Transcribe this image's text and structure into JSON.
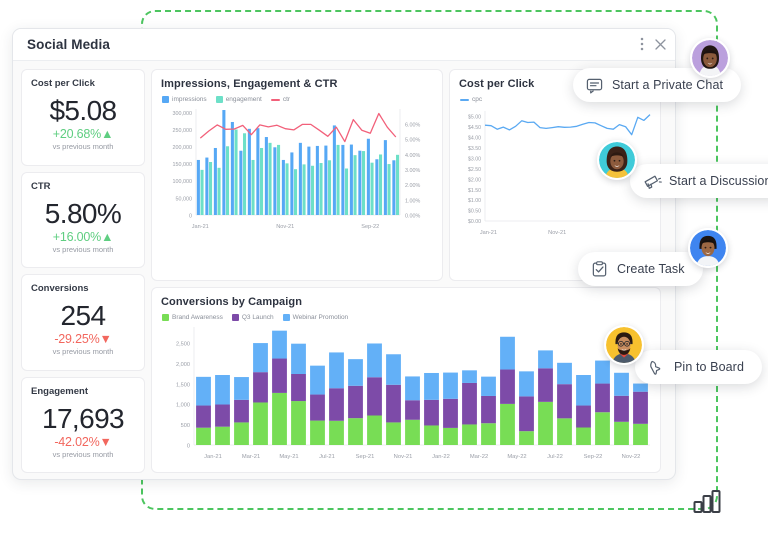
{
  "window": {
    "title": "Social Media",
    "menu_icon": "kebab-menu-icon",
    "close_icon": "close-icon"
  },
  "selection": {
    "icon": "bar-chart-icon",
    "color": "#4cc55f"
  },
  "kpis": [
    {
      "label": "Cost per Click",
      "value": "$5.08",
      "delta": "+20.68%",
      "arrow": "▲",
      "direction": "up",
      "sub": "vs previous month"
    },
    {
      "label": "CTR",
      "value": "5.80%",
      "delta": "+16.00%",
      "arrow": "▲",
      "direction": "up",
      "sub": "vs previous month"
    },
    {
      "label": "Conversions",
      "value": "254",
      "delta": "-29.25%",
      "arrow": "▼",
      "direction": "down",
      "sub": "vs previous month"
    },
    {
      "label": "Engagement",
      "value": "17,693",
      "delta": "-42.02%",
      "arrow": "▼",
      "direction": "down",
      "sub": "vs previous month"
    }
  ],
  "colors": {
    "impressions": "#56a8f5",
    "engagement": "#6de0c8",
    "ctr_line": "#f2607a",
    "cpc_line": "#5aa9f2",
    "brand_awareness": "#78dd55",
    "q3_launch": "#7d4ba8",
    "webinar_promotion": "#63b0f7",
    "positive": "#5fce81",
    "negative": "#f2675e"
  },
  "chart_data": [
    {
      "id": "impressions_engagement_ctr",
      "type": "bar",
      "title": "Impressions, Engagement & CTR",
      "legend": [
        {
          "name": "impressions",
          "marker": "square",
          "color": "#56a8f5"
        },
        {
          "name": "engagement",
          "marker": "square",
          "color": "#6de0c8"
        },
        {
          "name": "ctr",
          "marker": "line",
          "color": "#f2607a"
        }
      ],
      "legend_position": "top-left",
      "grid": false,
      "xlabel": "",
      "ylabel": "",
      "x_ticks": [
        "Jan-21",
        "Nov-21",
        "Sep-22"
      ],
      "x_tick_indices": [
        0,
        10,
        20
      ],
      "ylim": [
        0,
        310000
      ],
      "y_ticks": [
        "0",
        "50,000",
        "100,000",
        "150,000",
        "200,000",
        "250,000",
        "300,000"
      ],
      "y2_label": "CTR",
      "y2lim": [
        0,
        7
      ],
      "y2_ticks": [
        "0.00%",
        "1.00%",
        "2.00%",
        "3.00%",
        "4.00%",
        "5.00%",
        "6.00%"
      ],
      "categories": [
        "Jan-21",
        "Feb-21",
        "Mar-21",
        "Apr-21",
        "May-21",
        "Jun-21",
        "Jul-21",
        "Aug-21",
        "Sep-21",
        "Oct-21",
        "Nov-21",
        "Dec-21",
        "Jan-22",
        "Feb-22",
        "Mar-22",
        "Apr-22",
        "May-22",
        "Jun-22",
        "Jul-22",
        "Aug-22",
        "Sep-22",
        "Oct-22",
        "Nov-22",
        "Dec-22"
      ],
      "series": [
        {
          "name": "impressions",
          "axis": "left",
          "values": [
            161000,
            168000,
            196000,
            307000,
            272000,
            188000,
            252000,
            254000,
            228000,
            198000,
            161000,
            183000,
            211000,
            200000,
            202000,
            203000,
            262000,
            205000,
            206000,
            188000,
            223000,
            163000,
            219000,
            160000
          ]
        },
        {
          "name": "engagement",
          "axis": "left",
          "values": [
            132000,
            155000,
            138000,
            201000,
            250000,
            239000,
            161000,
            196000,
            211000,
            205000,
            151000,
            134000,
            148000,
            144000,
            152000,
            160000,
            205000,
            136000,
            175000,
            187000,
            153000,
            177000,
            149000,
            176000
          ]
        },
        {
          "name": "ctr",
          "axis": "right",
          "type": "line",
          "values": [
            5.08,
            5.55,
            5.95,
            5.66,
            5.68,
            5.92,
            5.3,
            5.95,
            5.82,
            5.93,
            5.7,
            5.62,
            5.98,
            5.98,
            5.6,
            5.2,
            5.8,
            4.85,
            6.3,
            5.6,
            5.4,
            6.7,
            5.8,
            5.15
          ]
        }
      ]
    },
    {
      "id": "cost_per_click",
      "type": "line",
      "title": "Cost per Click",
      "legend": [
        {
          "name": "cpc",
          "marker": "line",
          "color": "#5aa9f2"
        }
      ],
      "legend_position": "top-left",
      "grid": false,
      "xlabel": "",
      "ylabel": "",
      "x_ticks": [
        "Jan-21",
        "Nov-21"
      ],
      "x_tick_indices": [
        0,
        10
      ],
      "ylim": [
        0,
        5.25
      ],
      "y_ticks": [
        "$0.00",
        "$0.50",
        "$1.00",
        "$1.50",
        "$2.00",
        "$2.50",
        "$3.00",
        "$3.50",
        "$4.00",
        "$4.50",
        "$5.00"
      ],
      "categories": [
        "Jan-21",
        "Feb-21",
        "Mar-21",
        "Apr-21",
        "May-21",
        "Jun-21",
        "Jul-21",
        "Aug-21",
        "Sep-21",
        "Oct-21",
        "Nov-21",
        "Dec-21",
        "Jan-22",
        "Feb-22",
        "Mar-22",
        "Apr-22",
        "May-22",
        "Jun-22",
        "Jul-22",
        "Aug-22",
        "Sep-22",
        "Oct-22",
        "Nov-22",
        "Dec-22"
      ],
      "series": [
        {
          "name": "cpc",
          "values": [
            4.57,
            4.55,
            4.38,
            4.48,
            4.35,
            4.52,
            4.78,
            4.7,
            4.72,
            4.46,
            4.42,
            4.46,
            4.5,
            4.47,
            4.48,
            4.52,
            4.62,
            4.7,
            4.68,
            4.55,
            4.42,
            4.38,
            4.6,
            4.5,
            4.12,
            4.95,
            4.8,
            5.08
          ]
        }
      ]
    },
    {
      "id": "conversions_by_campaign",
      "type": "bar",
      "stacked": true,
      "title": "Conversions by Campaign",
      "legend": [
        {
          "name": "Brand Awareness",
          "marker": "square",
          "color": "#78dd55"
        },
        {
          "name": "Q3 Launch",
          "marker": "square",
          "color": "#7d4ba8"
        },
        {
          "name": "Webinar Promotion",
          "marker": "square",
          "color": "#63b0f7"
        }
      ],
      "legend_position": "top-left",
      "grid": false,
      "xlabel": "",
      "ylabel": "",
      "x_ticks": [
        "Jan-21",
        "Mar-21",
        "May-21",
        "Jul-21",
        "Sep-21",
        "Nov-21",
        "Jan-22",
        "Mar-22",
        "May-22",
        "Jul-22",
        "Sep-22",
        "Nov-22"
      ],
      "ylim": [
        0,
        2900
      ],
      "y_ticks": [
        "0",
        "500",
        "1,000",
        "1,500",
        "2,000",
        "2,500"
      ],
      "categories": [
        "Jan-21",
        "Feb-21",
        "Mar-21",
        "Apr-21",
        "May-21",
        "Jun-21",
        "Jul-21",
        "Aug-21",
        "Sep-21",
        "Oct-21",
        "Nov-21",
        "Dec-21",
        "Jan-22",
        "Feb-22",
        "Mar-22",
        "Apr-22",
        "May-22",
        "Jun-22",
        "Jul-22",
        "Aug-22",
        "Sep-22",
        "Oct-22",
        "Nov-22",
        "Dec-22"
      ],
      "series": [
        {
          "name": "Brand Awareness",
          "values": [
            425,
            450,
            555,
            1045,
            1280,
            1080,
            600,
            595,
            660,
            725,
            555,
            620,
            480,
            420,
            505,
            535,
            1010,
            340,
            1060,
            655,
            430,
            805,
            570,
            520
          ]
        },
        {
          "name": "Q3 Launch",
          "values": [
            545,
            545,
            555,
            745,
            845,
            665,
            640,
            800,
            795,
            940,
            925,
            480,
            630,
            715,
            1020,
            670,
            845,
            855,
            825,
            840,
            540,
            705,
            640,
            790
          ]
        },
        {
          "name": "Webinar Promotion",
          "values": [
            705,
            725,
            560,
            715,
            685,
            745,
            710,
            880,
            655,
            830,
            750,
            585,
            660,
            645,
            310,
            475,
            805,
            615,
            440,
            525,
            750,
            565,
            565,
            200
          ]
        }
      ]
    }
  ],
  "chips": [
    {
      "id": "chat",
      "label": "Start a Private Chat",
      "icon": "comment-icon"
    },
    {
      "id": "discussion",
      "label": "Start a Discussion",
      "icon": "megaphone-icon"
    },
    {
      "id": "task",
      "label": "Create Task",
      "icon": "clipboard-check-icon"
    },
    {
      "id": "pin",
      "label": "Pin to Board",
      "icon": "pin-cursor-icon"
    }
  ],
  "avatars": [
    {
      "id": "avatar-1",
      "name": "participant-avatar-1",
      "ring": "#b89bd9"
    },
    {
      "id": "avatar-2",
      "name": "participant-avatar-2",
      "ring": "#3fcbd9"
    },
    {
      "id": "avatar-3",
      "name": "participant-avatar-3",
      "ring": "#3f85f0"
    },
    {
      "id": "avatar-4",
      "name": "participant-avatar-4",
      "ring": "#f7c12e"
    }
  ]
}
